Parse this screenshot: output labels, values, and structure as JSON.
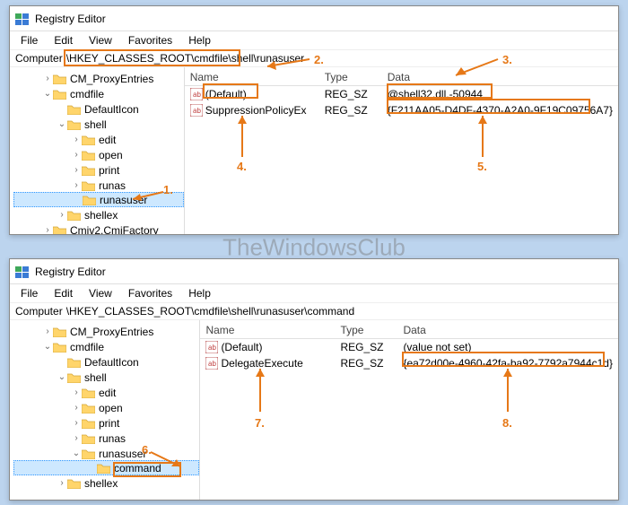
{
  "watermark": "TheWindowsClub",
  "windows": [
    {
      "title": "Registry Editor",
      "menus": [
        "File",
        "Edit",
        "View",
        "Favorites",
        "Help"
      ],
      "address_label": "Computer",
      "address_path": "\\HKEY_CLASSES_ROOT\\cmdfile\\shell\\runasuser",
      "tree": [
        {
          "indent": 2,
          "exp": ">",
          "label": "CM_ProxyEntries",
          "sel": false
        },
        {
          "indent": 2,
          "exp": "v",
          "label": "cmdfile",
          "sel": false
        },
        {
          "indent": 3,
          "exp": " ",
          "label": "DefaultIcon",
          "sel": false
        },
        {
          "indent": 3,
          "exp": "v",
          "label": "shell",
          "sel": false
        },
        {
          "indent": 4,
          "exp": ">",
          "label": "edit",
          "sel": false
        },
        {
          "indent": 4,
          "exp": ">",
          "label": "open",
          "sel": false
        },
        {
          "indent": 4,
          "exp": ">",
          "label": "print",
          "sel": false
        },
        {
          "indent": 4,
          "exp": ">",
          "label": "runas",
          "sel": false
        },
        {
          "indent": 4,
          "exp": " ",
          "label": "runasuser",
          "sel": true
        },
        {
          "indent": 3,
          "exp": ">",
          "label": "shellex",
          "sel": false
        },
        {
          "indent": 2,
          "exp": ">",
          "label": "Cmiv2.CmiFactory",
          "sel": false
        }
      ],
      "columns": {
        "name": "Name",
        "type": "Type",
        "data": "Data"
      },
      "rows": [
        {
          "name": "(Default)",
          "type": "REG_SZ",
          "data": "@shell32.dll,-50944"
        },
        {
          "name": "SuppressionPolicyEx",
          "type": "REG_SZ",
          "data": "{F211AA05-D4DF-4370-A2A0-9F19C09756A7}"
        }
      ],
      "annotations": [
        "1.",
        "2.",
        "3.",
        "4.",
        "5."
      ]
    },
    {
      "title": "Registry Editor",
      "menus": [
        "File",
        "Edit",
        "View",
        "Favorites",
        "Help"
      ],
      "address_label": "Computer",
      "address_path": "\\HKEY_CLASSES_ROOT\\cmdfile\\shell\\runasuser\\command",
      "tree": [
        {
          "indent": 2,
          "exp": ">",
          "label": "CM_ProxyEntries",
          "sel": false
        },
        {
          "indent": 2,
          "exp": "v",
          "label": "cmdfile",
          "sel": false
        },
        {
          "indent": 3,
          "exp": " ",
          "label": "DefaultIcon",
          "sel": false
        },
        {
          "indent": 3,
          "exp": "v",
          "label": "shell",
          "sel": false
        },
        {
          "indent": 4,
          "exp": ">",
          "label": "edit",
          "sel": false
        },
        {
          "indent": 4,
          "exp": ">",
          "label": "open",
          "sel": false
        },
        {
          "indent": 4,
          "exp": ">",
          "label": "print",
          "sel": false
        },
        {
          "indent": 4,
          "exp": ">",
          "label": "runas",
          "sel": false
        },
        {
          "indent": 4,
          "exp": "v",
          "label": "runasuser",
          "sel": false
        },
        {
          "indent": 5,
          "exp": " ",
          "label": "command",
          "sel": true
        },
        {
          "indent": 3,
          "exp": ">",
          "label": "shellex",
          "sel": false
        }
      ],
      "columns": {
        "name": "Name",
        "type": "Type",
        "data": "Data"
      },
      "rows": [
        {
          "name": "(Default)",
          "type": "REG_SZ",
          "data": "(value not set)"
        },
        {
          "name": "DelegateExecute",
          "type": "REG_SZ",
          "data": "{ea72d00e-4960-42fa-ba92-7792a7944c1d}"
        }
      ],
      "annotations": [
        "6.",
        "7.",
        "8."
      ]
    }
  ],
  "colors": {
    "accent": "#e67817"
  }
}
